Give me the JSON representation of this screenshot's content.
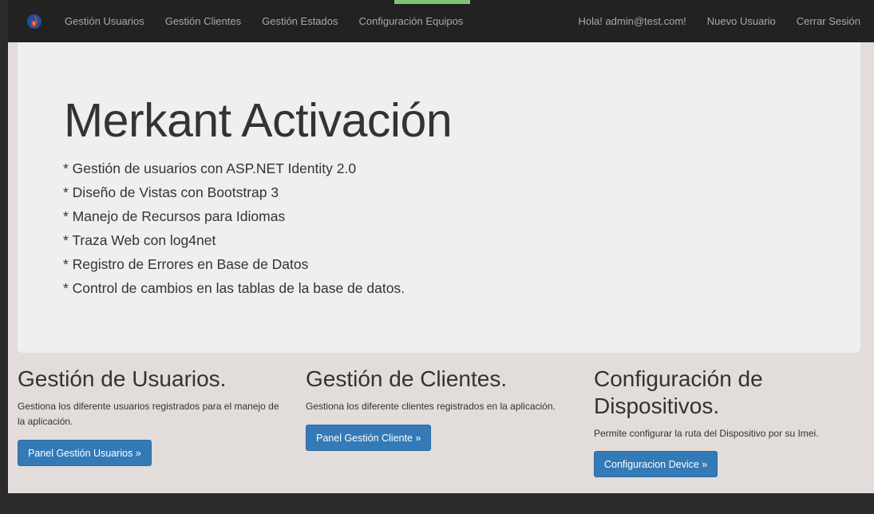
{
  "nav": {
    "brand_icon": "flame-logo-icon",
    "links": [
      "Gestión Usuarios",
      "Gestión Clientes",
      "Gestión Estados",
      "Configuración Equipos"
    ],
    "greeting": "Hola! admin@test.com!",
    "new_user": "Nuevo Usuario",
    "logout": "Cerrar Sesión"
  },
  "jumbotron": {
    "title": "Merkant Activación",
    "features": [
      "* Gestión de usuarios con ASP.NET Identity 2.0",
      "* Diseño de Vistas con Bootstrap 3",
      "* Manejo de Recursos para Idiomas",
      "* Traza Web con log4net",
      "* Registro de Errores en Base de Datos",
      "* Control de cambios en las tablas de la base de datos."
    ]
  },
  "columns": [
    {
      "title": "Gestión de Usuarios.",
      "text": "Gestiona los diferente usuarios registrados para el manejo de la aplicación.",
      "button": "Panel Gestión Usuarios »"
    },
    {
      "title": "Gestión de Clientes.",
      "text": "Gestiona los diferente clientes registrados en la aplicación.",
      "button": "Panel Gestión Cliente »"
    },
    {
      "title": "Configuración de Dispositivos.",
      "text": "Permite configurar la ruta del Dispositivo por su Imei.",
      "button": "Configuracion Device »"
    }
  ],
  "colors": {
    "navbar": "#222222",
    "primary_button": "#337ab7",
    "jumbotron": "#efefef",
    "page_background": "#e2dcdb",
    "nav_accent": "#7ec474"
  }
}
